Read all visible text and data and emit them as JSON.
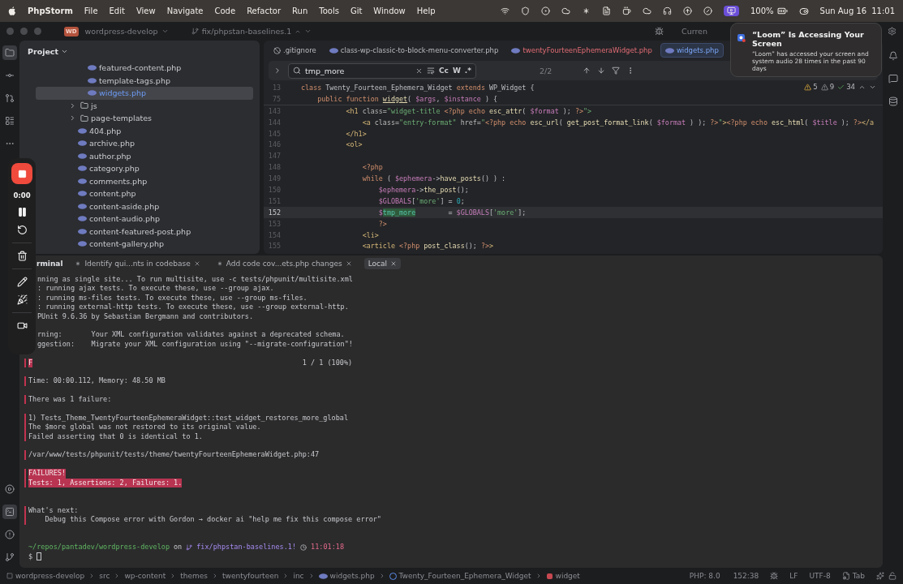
{
  "menu_bar": {
    "app": "PhpStorm",
    "menus": [
      "File",
      "Edit",
      "View",
      "Navigate",
      "Code",
      "Refactor",
      "Run",
      "Tools",
      "Git",
      "Window",
      "Help"
    ],
    "battery": "100%",
    "date": "Sun Aug 16",
    "time": "11:01"
  },
  "title_bar": {
    "project_badge": "WD",
    "project": "wordpress-develop",
    "branch": "fix/phpstan-baselines.1",
    "run_config": "Curren"
  },
  "notification": {
    "title": "“Loom” Is Accessing Your Screen",
    "body": "“Loom” has accessed your screen and system audio 28 times in the past 90 days"
  },
  "project_panel": {
    "title": "Project",
    "tree": [
      {
        "kind": "continued",
        "children": [
          {
            "label": "featured-content.php",
            "kind": "file",
            "selected": false
          },
          {
            "label": "template-tags.php",
            "kind": "file",
            "selected": false
          },
          {
            "label": "widgets.php",
            "kind": "file",
            "selected": true
          }
        ]
      },
      {
        "label": "js",
        "kind": "folder",
        "expanded": false,
        "selected": false
      },
      {
        "label": "page-templates",
        "kind": "folder",
        "expanded": false,
        "selected": false
      },
      {
        "label": "404.php",
        "kind": "file",
        "selected": false
      },
      {
        "label": "archive.php",
        "kind": "file",
        "selected": false
      },
      {
        "label": "author.php",
        "kind": "file",
        "selected": false
      },
      {
        "label": "category.php",
        "kind": "file",
        "selected": false
      },
      {
        "label": "comments.php",
        "kind": "file",
        "selected": false
      },
      {
        "label": "content.php",
        "kind": "file",
        "selected": false
      },
      {
        "label": "content-aside.php",
        "kind": "file",
        "selected": false
      },
      {
        "label": "content-audio.php",
        "kind": "file",
        "selected": false
      },
      {
        "label": "content-featured-post.php",
        "kind": "file",
        "selected": false
      },
      {
        "label": "content-gallery.php",
        "kind": "file",
        "selected": false
      }
    ]
  },
  "editor": {
    "tabs": [
      {
        "label": ".gitignore",
        "kind": "ignore",
        "selected": false,
        "has_errors": false
      },
      {
        "label": "class-wp-classic-to-block-menu-converter.php",
        "kind": "php",
        "selected": false,
        "has_errors": false
      },
      {
        "label": "twentyFourteenEphemeraWidget.php",
        "kind": "php",
        "selected": false,
        "has_errors": true
      },
      {
        "label": "widgets.php",
        "kind": "php",
        "selected": true,
        "has_errors": false
      }
    ],
    "find": {
      "value": "tmp_more",
      "options": [
        "Cc",
        "W",
        ".*"
      ],
      "count": "2/2"
    },
    "inspections": {
      "warnings": "5",
      "weak_warnings": "9",
      "passed": "34"
    },
    "sticky_lines": [
      {
        "number": "13",
        "tokens": [
          {
            "text": "class ",
            "kind": "kw"
          },
          {
            "text": "Twenty_Fourteen_Ephemera_Widget ",
            "kind": "p"
          },
          {
            "text": "extends ",
            "kind": "kw"
          },
          {
            "text": "WP_Widget {",
            "kind": "p"
          }
        ]
      },
      {
        "number": "75",
        "tokens": [
          {
            "text": "    public function ",
            "kind": "kw"
          },
          {
            "text": "widget",
            "kind": "fn"
          },
          {
            "text": "( ",
            "kind": "p"
          },
          {
            "text": "$args",
            "kind": "var"
          },
          {
            "text": ", ",
            "kind": "p"
          },
          {
            "text": "$instance",
            "kind": "var"
          },
          {
            "text": " ) {",
            "kind": "p"
          }
        ]
      }
    ],
    "lines": [
      {
        "number": "143",
        "current": false,
        "tokens": [
          {
            "text": "           <h1 ",
            "kind": "tag"
          },
          {
            "text": "class=",
            "kind": "attr"
          },
          {
            "text": "\"widget-title ",
            "kind": "str"
          },
          {
            "text": "<?php ",
            "kind": "php"
          },
          {
            "text": "echo ",
            "kind": "kw"
          },
          {
            "text": "esc_attr",
            "kind": "fn"
          },
          {
            "text": "( ",
            "kind": "p"
          },
          {
            "text": "$format",
            "kind": "var"
          },
          {
            "text": " ); ",
            "kind": "p"
          },
          {
            "text": "?>",
            "kind": "php"
          },
          {
            "text": "\">",
            "kind": "str"
          }
        ]
      },
      {
        "number": "144",
        "current": false,
        "tokens": [
          {
            "text": "               <a ",
            "kind": "tag"
          },
          {
            "text": "class=",
            "kind": "attr"
          },
          {
            "text": "\"entry-format\" ",
            "kind": "str"
          },
          {
            "text": "href=",
            "kind": "attr"
          },
          {
            "text": "\"",
            "kind": "str"
          },
          {
            "text": "<?php ",
            "kind": "php"
          },
          {
            "text": "echo ",
            "kind": "kw"
          },
          {
            "text": "esc_url",
            "kind": "fn"
          },
          {
            "text": "( ",
            "kind": "p"
          },
          {
            "text": "get_post_format_link",
            "kind": "fn"
          },
          {
            "text": "( ",
            "kind": "p"
          },
          {
            "text": "$format",
            "kind": "var"
          },
          {
            "text": " ) ); ",
            "kind": "p"
          },
          {
            "text": "?>",
            "kind": "php"
          },
          {
            "text": "\"",
            "kind": "str"
          },
          {
            "text": ">",
            "kind": "tag"
          },
          {
            "text": "<?php ",
            "kind": "php"
          },
          {
            "text": "echo ",
            "kind": "kw"
          },
          {
            "text": "esc_html",
            "kind": "fn"
          },
          {
            "text": "( ",
            "kind": "p"
          },
          {
            "text": "$title",
            "kind": "var"
          },
          {
            "text": " ); ",
            "kind": "p"
          },
          {
            "text": "?>",
            "kind": "php"
          },
          {
            "text": "</a",
            "kind": "tag"
          }
        ]
      },
      {
        "number": "145",
        "current": false,
        "tokens": [
          {
            "text": "           </h1>",
            "kind": "tag"
          }
        ]
      },
      {
        "number": "146",
        "current": false,
        "tokens": [
          {
            "text": "           <ol>",
            "kind": "tag"
          }
        ]
      },
      {
        "number": "147",
        "current": false
      },
      {
        "number": "148",
        "current": false,
        "tokens": [
          {
            "text": "               <?php",
            "kind": "php"
          }
        ]
      },
      {
        "number": "149",
        "current": false,
        "tokens": [
          {
            "text": "               while",
            "kind": "kw"
          },
          {
            "text": " ( ",
            "kind": "p"
          },
          {
            "text": "$ephemera",
            "kind": "var"
          },
          {
            "text": "->",
            "kind": "p"
          },
          {
            "text": "have_posts",
            "kind": "fn"
          },
          {
            "text": "() ) :",
            "kind": "p"
          }
        ]
      },
      {
        "number": "150",
        "current": false,
        "tokens": [
          {
            "text": "                   $ephemera",
            "kind": "var"
          },
          {
            "text": "->",
            "kind": "p"
          },
          {
            "text": "the_post",
            "kind": "fn"
          },
          {
            "text": "();",
            "kind": "p"
          }
        ]
      },
      {
        "number": "151",
        "current": false,
        "tokens": [
          {
            "text": "                   $GLOBALS",
            "kind": "var"
          },
          {
            "text": "[",
            "kind": "p"
          },
          {
            "text": "'more'",
            "kind": "str"
          },
          {
            "text": "] = ",
            "kind": "p"
          },
          {
            "text": "0",
            "kind": "num"
          },
          {
            "text": ";",
            "kind": "p"
          }
        ]
      },
      {
        "number": "152",
        "current": true,
        "tokens": [
          {
            "text": "                   $",
            "kind": "var"
          },
          {
            "text": "tmp_more",
            "kind": "match"
          },
          {
            "text": "        = ",
            "kind": "p"
          },
          {
            "text": "$GLOBALS",
            "kind": "var"
          },
          {
            "text": "[",
            "kind": "p"
          },
          {
            "text": "'more'",
            "kind": "str"
          },
          {
            "text": "];",
            "kind": "p"
          }
        ]
      },
      {
        "number": "153",
        "current": false,
        "tokens": [
          {
            "text": "                   ?>",
            "kind": "php"
          }
        ]
      },
      {
        "number": "154",
        "current": false,
        "tokens": [
          {
            "text": "               <li>",
            "kind": "tag"
          }
        ]
      },
      {
        "number": "155",
        "current": false,
        "tokens": [
          {
            "text": "               <article ",
            "kind": "tag"
          },
          {
            "text": "<?php ",
            "kind": "php"
          },
          {
            "text": "post_class",
            "kind": "fn"
          },
          {
            "text": "(); ",
            "kind": "p"
          },
          {
            "text": "?>",
            "kind": "php"
          },
          {
            "text": ">",
            "kind": "tag"
          }
        ]
      }
    ]
  },
  "terminal": {
    "title": "rminal",
    "tabs": [
      {
        "label": "Identify qui...nts in codebase",
        "kind": "agent",
        "selected": false
      },
      {
        "label": "Add code cov...ets.php changes",
        "kind": "agent",
        "selected": false
      },
      {
        "label": "Local",
        "kind": "shell",
        "selected": true
      }
    ],
    "lines": [
      {
        "kind": "cut",
        "text": "nning as single site... To run multisite, use -c tests/phpunit/multisite.xml"
      },
      {
        "kind": "cut",
        "text": ": running ajax tests. To execute these, use --group ajax."
      },
      {
        "kind": "cut",
        "text": ": running ms-files tests. To execute these, use --group ms-files."
      },
      {
        "kind": "cut",
        "text": ": running external-http tests. To execute these, use --group external-http."
      },
      {
        "kind": "cut",
        "text": "PUnit 9.6.36 by Sebastian Bergmann and contributors."
      },
      {
        "kind": "cut",
        "blank_before": true,
        "text": "rning:       Your XML configuration validates against a deprecated schema."
      },
      {
        "kind": "cut",
        "text": "ggestion:    Migrate your XML configuration using \"--migrate-configuration\"!"
      },
      {
        "kind": "progress",
        "blank_before": true,
        "in_block": true,
        "mark": "F",
        "text": "1 / 1 (100%)"
      },
      {
        "kind": "out",
        "blank_before": true,
        "in_block": true,
        "text": "Time: 00:00.112, Memory: 48.50 MB"
      },
      {
        "kind": "out",
        "blank_before": true,
        "in_block": true,
        "text": "There was 1 failure:"
      },
      {
        "kind": "out",
        "blank_before": true,
        "in_block": true,
        "text": "1) Tests_Theme_TwentyFourteenEphemeraWidget::test_widget_restores_more_global"
      },
      {
        "kind": "out",
        "in_block": true,
        "text": "The $more global was not restored to its original value."
      },
      {
        "kind": "out",
        "in_block": true,
        "text": "Failed asserting that 0 is identical to 1."
      },
      {
        "kind": "out",
        "blank_before": true,
        "in_block": true,
        "text": "/var/www/tests/phpunit/tests/theme/twentyFourteenEphemeraWidget.php:47"
      },
      {
        "kind": "fail",
        "blank_before": true,
        "in_block": true,
        "text": "FAILURES!"
      },
      {
        "kind": "fail",
        "in_block": true,
        "text": "Tests: 1, Assertions: 2, Failures: 1."
      },
      {
        "kind": "out",
        "blank_before": true,
        "extra_blank": true,
        "in_block": true,
        "text": "What's next:"
      },
      {
        "kind": "out",
        "in_block": true,
        "text": "    Debug this Compose error with Gordon → docker ai \"help me fix this compose error\""
      },
      {
        "kind": "prompt",
        "blank_before": true,
        "extra_blank": true,
        "path": "~/repos/pantadev/wordpress-develop",
        "joiner": "on",
        "branch": "fix/phpstan-baselines.1!",
        "time": "11:01:18"
      },
      {
        "kind": "input",
        "text": "$"
      }
    ]
  },
  "recorder": {
    "elapsed": "0:00"
  },
  "status_bar": {
    "breadcrumb": [
      {
        "label": "wordpress-develop",
        "kind": "module"
      },
      {
        "label": "src",
        "kind": "dir"
      },
      {
        "label": "wp-content",
        "kind": "dir"
      },
      {
        "label": "themes",
        "kind": "dir"
      },
      {
        "label": "twentyfourteen",
        "kind": "dir"
      },
      {
        "label": "inc",
        "kind": "dir"
      },
      {
        "label": "widgets.php",
        "kind": "file"
      },
      {
        "label": "Twenty_Fourteen_Ephemera_Widget",
        "kind": "class"
      },
      {
        "label": "widget",
        "kind": "method"
      }
    ],
    "php": "PHP: 8.0",
    "position": "152:38",
    "line_separator": "LF",
    "encoding": "UTF-8",
    "indent": "Tab"
  }
}
